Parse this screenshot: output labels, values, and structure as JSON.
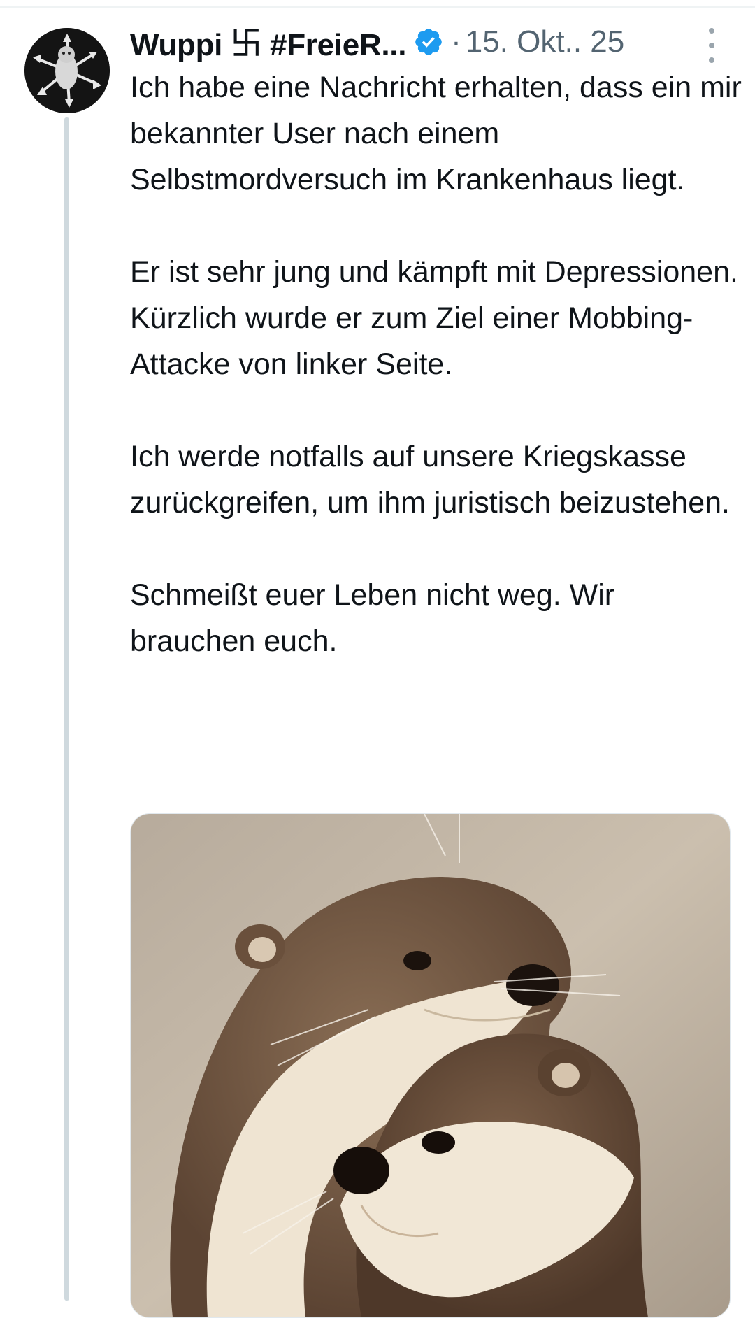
{
  "tweet": {
    "display_name": "Wuppi ࿕ #FreieR...",
    "separator": "·",
    "date": "15. Okt.. 25",
    "paragraphs": [
      "Ich habe eine Nachricht erhalten, dass ein mir bekannter User nach einem Selbstmordversuch im Krankenhaus liegt.",
      "Er ist sehr jung und kämpft mit Depressionen. Kürzlich wurde er zum Ziel einer Mobbing-Attacke von linker Seite.",
      "Ich werde notfalls auf unsere Kriegskasse zurückgreifen, um ihm juristisch beizustehen.",
      "Schmeißt euer Leben nicht weg. Wir brauchen euch."
    ],
    "media_icon": "otter-photo",
    "verified_icon": "verified-badge-icon",
    "more_icon": "more-options-icon"
  },
  "colors": {
    "text": "#0f1419",
    "secondary": "#536471",
    "verified": "#1d9bf0",
    "thread_line": "#cfd9de"
  }
}
